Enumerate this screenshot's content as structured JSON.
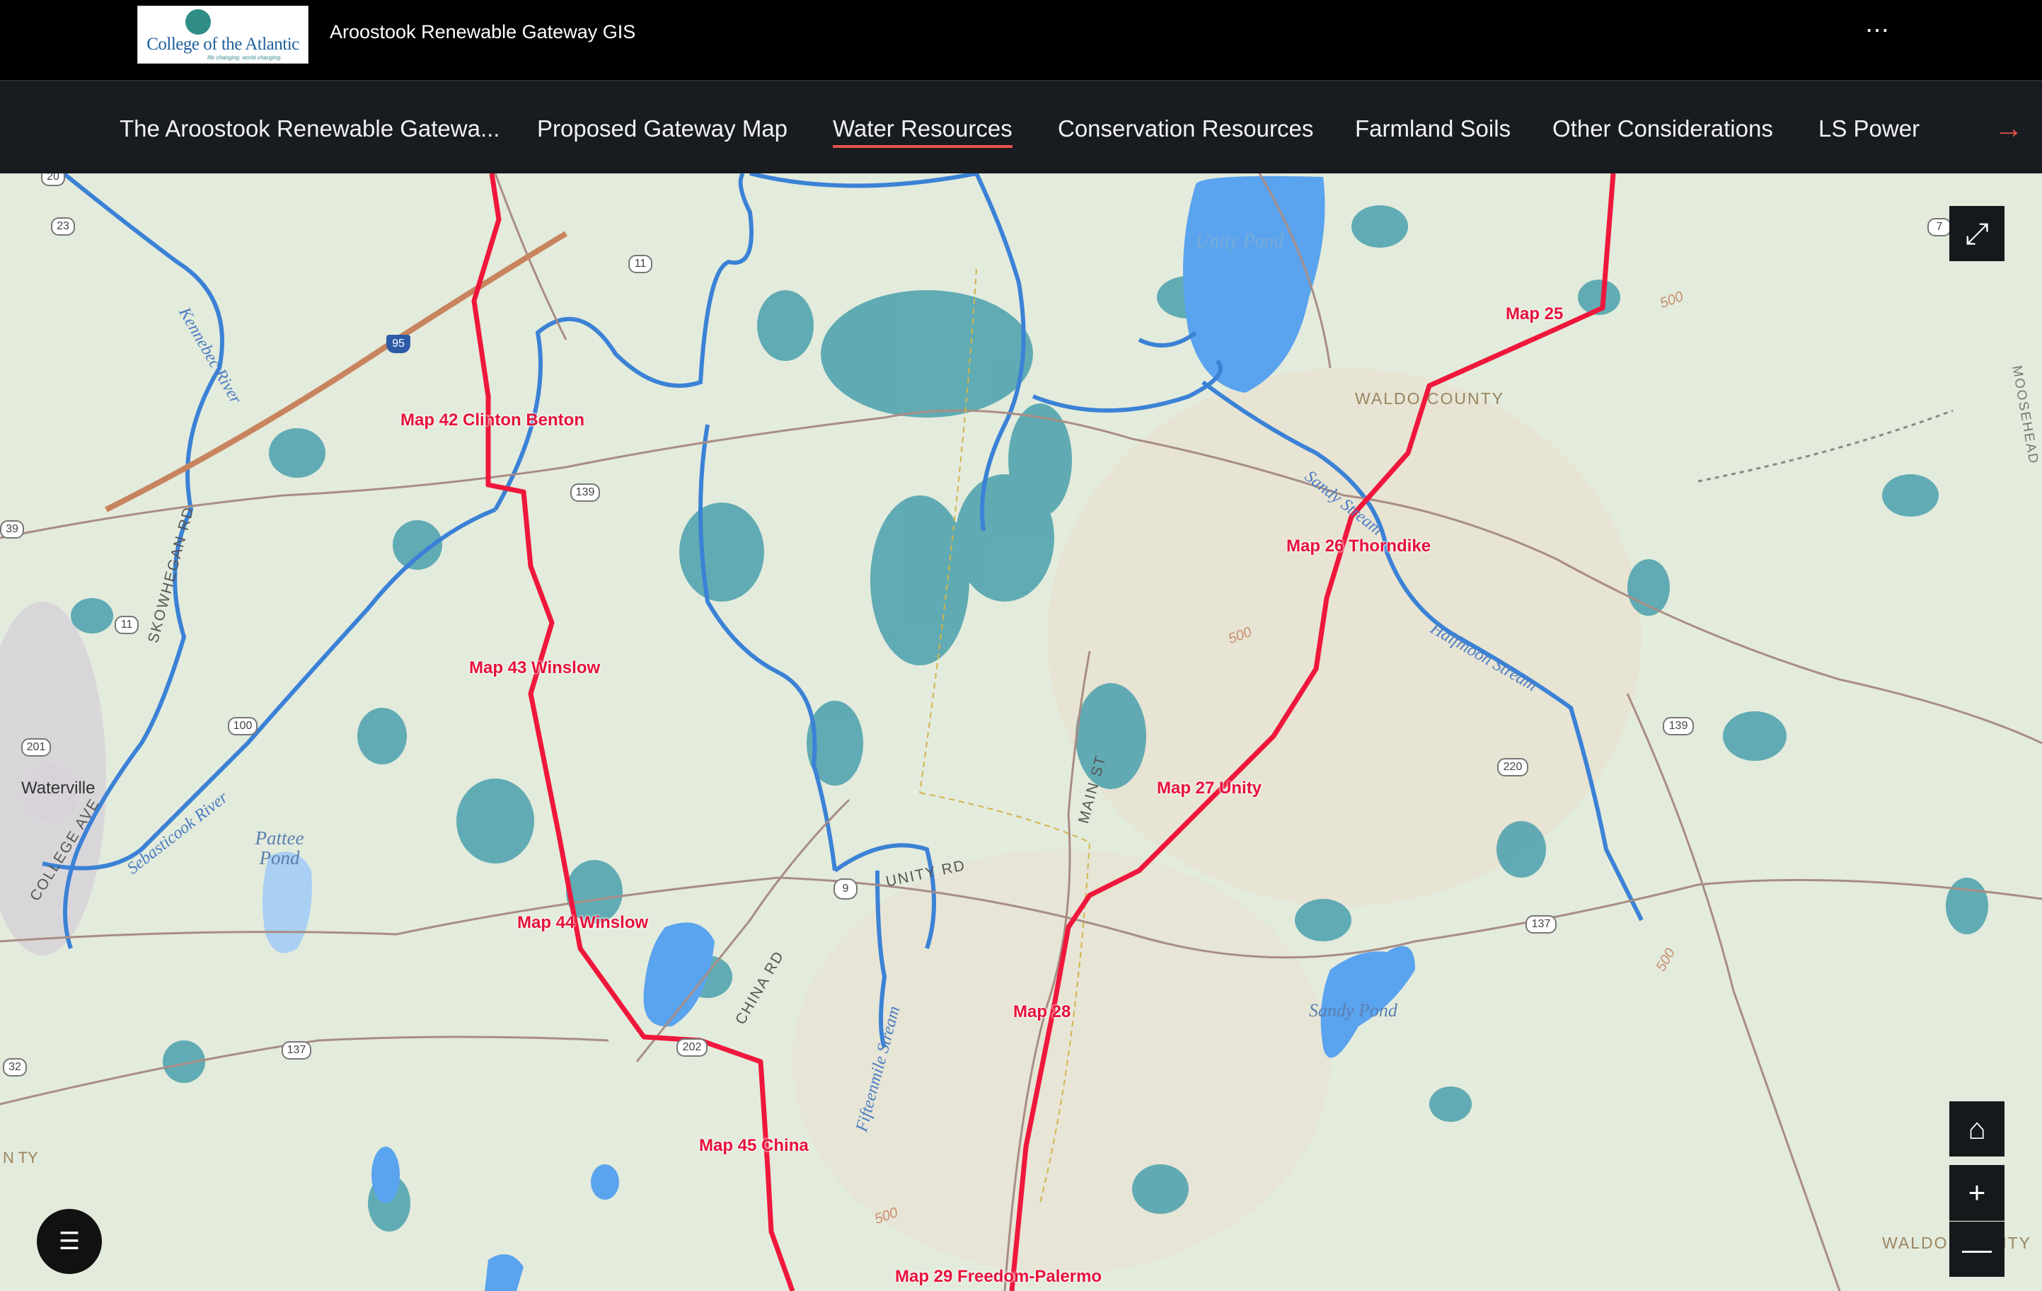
{
  "header": {
    "logo": {
      "name": "College of the Atlantic",
      "tagline": "life changing. world changing."
    },
    "app_title": "Aroostook Renewable Gateway GIS",
    "more_icon": "⋯"
  },
  "nav": {
    "tabs": [
      {
        "label": "The Aroostook Renewable Gatewa...",
        "active": false
      },
      {
        "label": "Proposed Gateway Map",
        "active": false
      },
      {
        "label": "Water Resources",
        "active": true
      },
      {
        "label": "Conservation Resources",
        "active": false
      },
      {
        "label": "Farmland Soils",
        "active": false
      },
      {
        "label": "Other Considerations",
        "active": false
      },
      {
        "label": "LS Power",
        "active": false
      }
    ],
    "next_icon": "→",
    "accent_color": "#e5534b"
  },
  "map": {
    "route_color": "#f0173c",
    "water_color": "#3b82d6",
    "wetland_color": "#3e9aa8",
    "route_labels": [
      "Map 42 Clinton Benton",
      "Map 43 Winslow",
      "Map 44 Winslow",
      "Map 45 China",
      "Map 25",
      "Map 26 Thorndike",
      "Map 27 Unity",
      "Map 28",
      "Map 29 Freedom-Palermo"
    ],
    "places": [
      "Unity Pond",
      "WALDO COUNTY",
      "Pattee Pond",
      "Waterville",
      "Sandy Pond",
      "WALDO COUNTY",
      "N TY"
    ],
    "water_labels": [
      "Sandy Stream",
      "Halfmoon Stream",
      "Fifteenmile Stream",
      "Kennebec River",
      "Sebasticook River"
    ],
    "roads": [
      "SKOWHEGAN RD",
      "COLLEGE AVE",
      "MAIN ST",
      "UNITY RD",
      "CHINA RD",
      "MOOSEHEAD"
    ],
    "shields": [
      "20",
      "23",
      "11",
      "95",
      "139",
      "39",
      "11",
      "100",
      "201",
      "9",
      "202",
      "137",
      "32",
      "220",
      "139",
      "137",
      "7"
    ],
    "contours": [
      "500",
      "500",
      "500",
      "500"
    ]
  },
  "controls": {
    "expand_icon": "⤢",
    "home_icon": "⌂",
    "zoom_in": "+",
    "zoom_out": "—",
    "legend_icon": "☰"
  }
}
